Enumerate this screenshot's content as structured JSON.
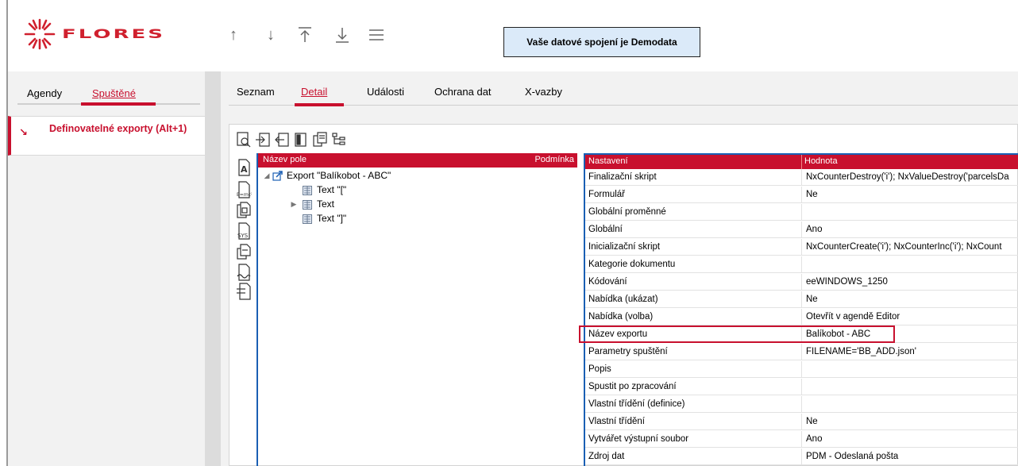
{
  "header": {
    "logo_text": "FLORES",
    "toolbar_icons": [
      "arrow-up-icon",
      "arrow-down-icon",
      "arrow-to-top-icon",
      "arrow-to-bottom-icon",
      "menu-icon"
    ],
    "connection_text": "Vaše datové spojení je Demodata"
  },
  "colors": {
    "accent": "#c8102e",
    "selection": "#1a5fb4",
    "connection_bg": "#dbeaf9"
  },
  "left": {
    "tabs": [
      {
        "label": "Agendy",
        "active": false
      },
      {
        "label": "Spuštěné",
        "active": true
      }
    ],
    "items": [
      {
        "label": "Definovatelné exporty (Alt+1)",
        "icon": "arrow-down-right-icon"
      }
    ]
  },
  "right": {
    "tabs": [
      {
        "label": "Seznam",
        "active": false
      },
      {
        "label": "Detail",
        "active": true
      },
      {
        "label": "Události",
        "active": false
      },
      {
        "label": "Ochrana dat",
        "active": false
      },
      {
        "label": "X-vazby",
        "active": false
      }
    ]
  },
  "toolbar": {
    "icons": [
      "preview-icon",
      "import-icon",
      "export-icon",
      "page-icon",
      "copy-icon",
      "tree-icon"
    ]
  },
  "side_tools": {
    "icons": [
      "text-field-icon",
      "formula-icon",
      "file-field-icon",
      "system-field-icon",
      "copy-field-icon",
      "loop-field-icon",
      "align-field-icon"
    ]
  },
  "tree": {
    "columns": {
      "name": "Název pole",
      "condition": "Podmínka"
    },
    "rows": [
      {
        "label": "Export \"Balíkobot - ABC\"",
        "level": 0,
        "expander": "◢",
        "icon": "export-icon"
      },
      {
        "label": "Text \"[\"",
        "level": 1,
        "expander": "",
        "icon": "text-icon"
      },
      {
        "label": "Text",
        "level": 1,
        "expander": "▶",
        "icon": "text-icon"
      },
      {
        "label": "Text \"]\"",
        "level": 1,
        "expander": "",
        "icon": "text-icon"
      }
    ]
  },
  "props": {
    "columns": {
      "key": "Nastavení",
      "value": "Hodnota"
    },
    "rows": [
      {
        "key": "Finalizační skript",
        "value": "NxCounterDestroy('i'); NxValueDestroy('parcelsDa"
      },
      {
        "key": "Formulář",
        "value": "Ne"
      },
      {
        "key": "Globální proměnné",
        "value": ""
      },
      {
        "key": "Globální",
        "value": "Ano"
      },
      {
        "key": "Inicializační skript",
        "value": "NxCounterCreate('i'); NxCounterInc('i'); NxCount"
      },
      {
        "key": "Kategorie dokumentu",
        "value": ""
      },
      {
        "key": "Kódování",
        "value": "eeWINDOWS_1250"
      },
      {
        "key": "Nabídka (ukázat)",
        "value": "Ne"
      },
      {
        "key": "Nabídka (volba)",
        "value": "Otevřít v agendě Editor"
      },
      {
        "key": "Název exportu",
        "value": "Balíkobot - ABC",
        "highlighted": true
      },
      {
        "key": "Parametry spuštění",
        "value": "FILENAME='BB_ADD.json'"
      },
      {
        "key": "Popis",
        "value": ""
      },
      {
        "key": "Spustit po zpracování",
        "value": ""
      },
      {
        "key": "Vlastní třídění (definice)",
        "value": ""
      },
      {
        "key": "Vlastní třídění",
        "value": "Ne"
      },
      {
        "key": "Vytvářet výstupní soubor",
        "value": "Ano"
      },
      {
        "key": "Zdroj dat",
        "value": "PDM - Odeslaná pošta"
      }
    ]
  }
}
